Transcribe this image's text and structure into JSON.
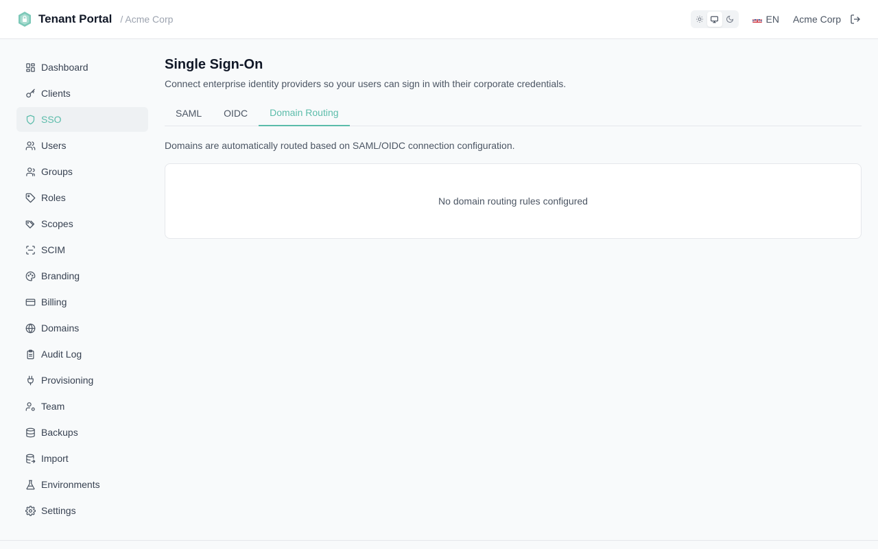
{
  "header": {
    "brand_title": "Tenant Portal",
    "breadcrumb": "/ Acme Corp",
    "language": "EN",
    "tenant_name": "Acme Corp",
    "theme_options": [
      "sun-icon",
      "monitor-icon",
      "moon-icon"
    ],
    "theme_selected": "monitor-icon"
  },
  "sidebar": {
    "items": [
      {
        "label": "Dashboard",
        "icon": "dashboard-icon"
      },
      {
        "label": "Clients",
        "icon": "key-icon"
      },
      {
        "label": "SSO",
        "icon": "shield-icon",
        "active": true
      },
      {
        "label": "Users",
        "icon": "users-icon"
      },
      {
        "label": "Groups",
        "icon": "group-icon"
      },
      {
        "label": "Roles",
        "icon": "tag-icon"
      },
      {
        "label": "Scopes",
        "icon": "tags-icon"
      },
      {
        "label": "SCIM",
        "icon": "scan-icon"
      },
      {
        "label": "Branding",
        "icon": "palette-icon"
      },
      {
        "label": "Billing",
        "icon": "credit-card-icon"
      },
      {
        "label": "Domains",
        "icon": "globe-icon"
      },
      {
        "label": "Audit Log",
        "icon": "clipboard-icon"
      },
      {
        "label": "Provisioning",
        "icon": "plug-icon"
      },
      {
        "label": "Team",
        "icon": "user-cog-icon"
      },
      {
        "label": "Backups",
        "icon": "database-icon"
      },
      {
        "label": "Import",
        "icon": "database-import-icon"
      },
      {
        "label": "Environments",
        "icon": "flask-icon"
      },
      {
        "label": "Settings",
        "icon": "gear-icon"
      }
    ]
  },
  "main": {
    "title": "Single Sign-On",
    "subtitle": "Connect enterprise identity providers so your users can sign in with their corporate credentials.",
    "tabs": [
      {
        "label": "SAML"
      },
      {
        "label": "OIDC"
      },
      {
        "label": "Domain Routing",
        "active": true
      }
    ],
    "section_description": "Domains are automatically routed based on SAML/OIDC connection configuration.",
    "empty_state": "No domain routing rules configured"
  },
  "colors": {
    "accent": "#5bbcaa",
    "active_bg": "#eef1f3",
    "page_bg": "#f8fafb"
  }
}
